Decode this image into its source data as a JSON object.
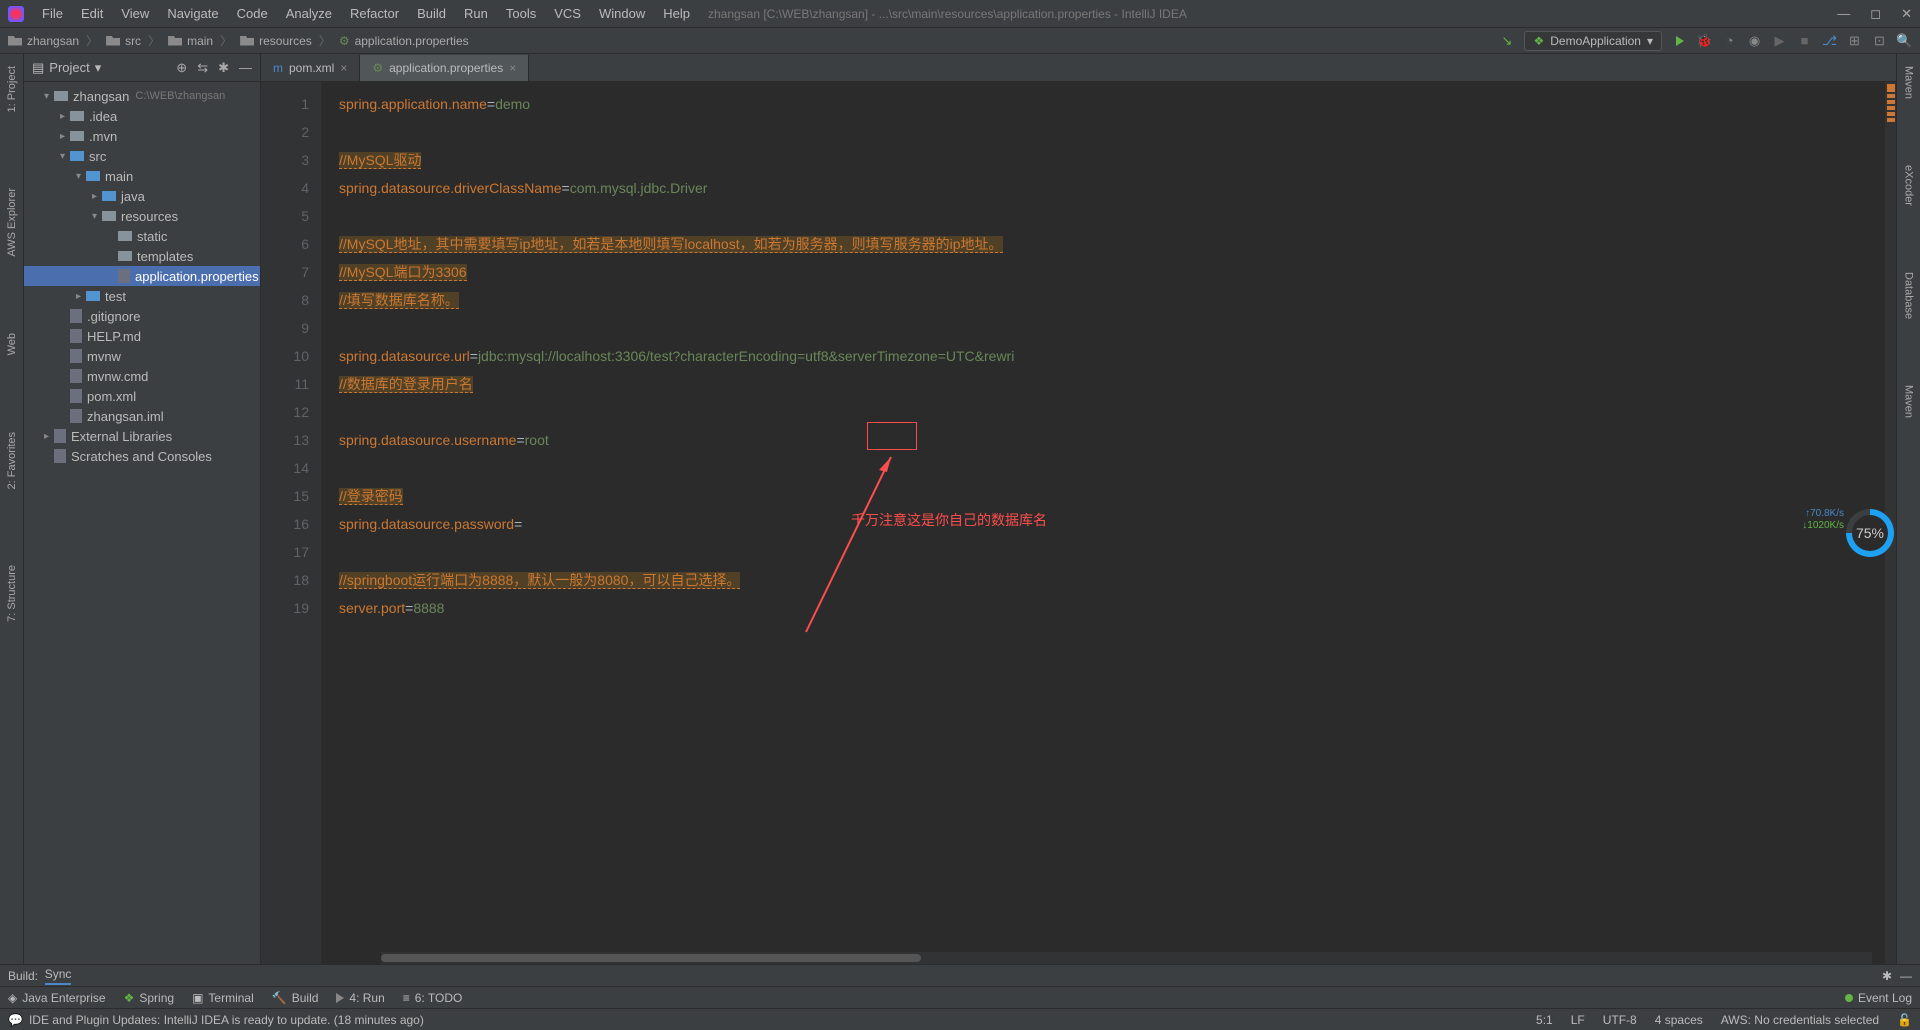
{
  "title": {
    "project": "zhangsan",
    "full": "zhangsan [C:\\WEB\\zhangsan] - ...\\src\\main\\resources\\application.properties - IntelliJ IDEA"
  },
  "menu": [
    "File",
    "Edit",
    "View",
    "Navigate",
    "Code",
    "Analyze",
    "Refactor",
    "Build",
    "Run",
    "Tools",
    "VCS",
    "Window",
    "Help"
  ],
  "breadcrumb": [
    "zhangsan",
    "src",
    "main",
    "resources",
    "application.properties"
  ],
  "run_config": "DemoApplication",
  "project_panel": "Project",
  "tree": {
    "root": "zhangsan",
    "root_path": "C:\\WEB\\zhangsan",
    "items": [
      {
        "depth": 1,
        "arrow": "▾",
        "icon": "folder",
        "label": "zhangsan",
        "path": "C:\\WEB\\zhangsan"
      },
      {
        "depth": 2,
        "arrow": "▸",
        "icon": "folder",
        "label": ".idea"
      },
      {
        "depth": 2,
        "arrow": "▸",
        "icon": "folder",
        "label": ".mvn"
      },
      {
        "depth": 2,
        "arrow": "▾",
        "icon": "folder-blue",
        "label": "src"
      },
      {
        "depth": 3,
        "arrow": "▾",
        "icon": "folder-blue",
        "label": "main"
      },
      {
        "depth": 4,
        "arrow": "▸",
        "icon": "folder-blue",
        "label": "java"
      },
      {
        "depth": 4,
        "arrow": "▾",
        "icon": "folder",
        "label": "resources"
      },
      {
        "depth": 5,
        "arrow": " ",
        "icon": "folder",
        "label": "static"
      },
      {
        "depth": 5,
        "arrow": " ",
        "icon": "folder",
        "label": "templates"
      },
      {
        "depth": 5,
        "arrow": " ",
        "icon": "file",
        "label": "application.properties",
        "selected": true
      },
      {
        "depth": 3,
        "arrow": "▸",
        "icon": "folder-blue",
        "label": "test"
      },
      {
        "depth": 2,
        "arrow": " ",
        "icon": "file",
        "label": ".gitignore"
      },
      {
        "depth": 2,
        "arrow": " ",
        "icon": "file",
        "label": "HELP.md"
      },
      {
        "depth": 2,
        "arrow": " ",
        "icon": "file",
        "label": "mvnw"
      },
      {
        "depth": 2,
        "arrow": " ",
        "icon": "file",
        "label": "mvnw.cmd"
      },
      {
        "depth": 2,
        "arrow": " ",
        "icon": "file",
        "label": "pom.xml"
      },
      {
        "depth": 2,
        "arrow": " ",
        "icon": "file",
        "label": "zhangsan.iml"
      },
      {
        "depth": 1,
        "arrow": "▸",
        "icon": "lib",
        "label": "External Libraries"
      },
      {
        "depth": 1,
        "arrow": " ",
        "icon": "scratch",
        "label": "Scratches and Consoles"
      }
    ]
  },
  "editor_tabs": [
    {
      "label": "pom.xml",
      "active": false
    },
    {
      "label": "application.properties",
      "active": true
    }
  ],
  "line_count": 19,
  "code": {
    "l1_k": "spring.application.name",
    "l1_v": "demo",
    "l3": "//MySQL驱动",
    "l4_k": "spring.datasource.driverClassName",
    "l4_v": "com.mysql.jdbc.Driver",
    "l6": "//MySQL地址，其中需要填写ip地址，如若是本地则填写localhost，如若为服务器，则填写服务器的ip地址。",
    "l7": "//MySQL端口为3306",
    "l8": "//填写数据库名称。",
    "l10_k": "spring.datasource.url",
    "l10_v": "jdbc:mysql://localhost:3306/test?characterEncoding=utf8&serverTimezone=UTC&rewri",
    "l11": "//数据库的登录用户名",
    "l13_k": "spring.datasource.username",
    "l13_v": "root",
    "l15": "//登录密码",
    "l16_k": "spring.datasource.password",
    "l16_v": "",
    "l18": "//springboot运行端口为8888，默认一般为8080，可以自己选择。",
    "l19_k": "server.port",
    "l19_v": "8888"
  },
  "annotation": "千万注意这是你自己的数据库名",
  "left_tabs": [
    "1: Project",
    "AWS Explorer",
    "Web",
    "2: Favorites",
    "7: Structure"
  ],
  "right_tabs": [
    "Maven",
    "eXcoder",
    "Database",
    "Maven"
  ],
  "tool_tabs": [
    "Java Enterprise",
    "Spring",
    "Terminal",
    "Build",
    "4: Run",
    "6: TODO"
  ],
  "build_label": "Build:",
  "build_tab": "Sync",
  "status": {
    "msg": "IDE and Plugin Updates: IntelliJ IDEA is ready to update. (18 minutes ago)",
    "pos": "5:1",
    "sep": "LF",
    "enc": "UTF-8",
    "indent": "4 spaces",
    "aws": "AWS: No credentials selected",
    "eventlog": "Event Log"
  },
  "gauge": "75%",
  "net_up": "↑70.8K/s",
  "net_dn": "↓1020K/s"
}
